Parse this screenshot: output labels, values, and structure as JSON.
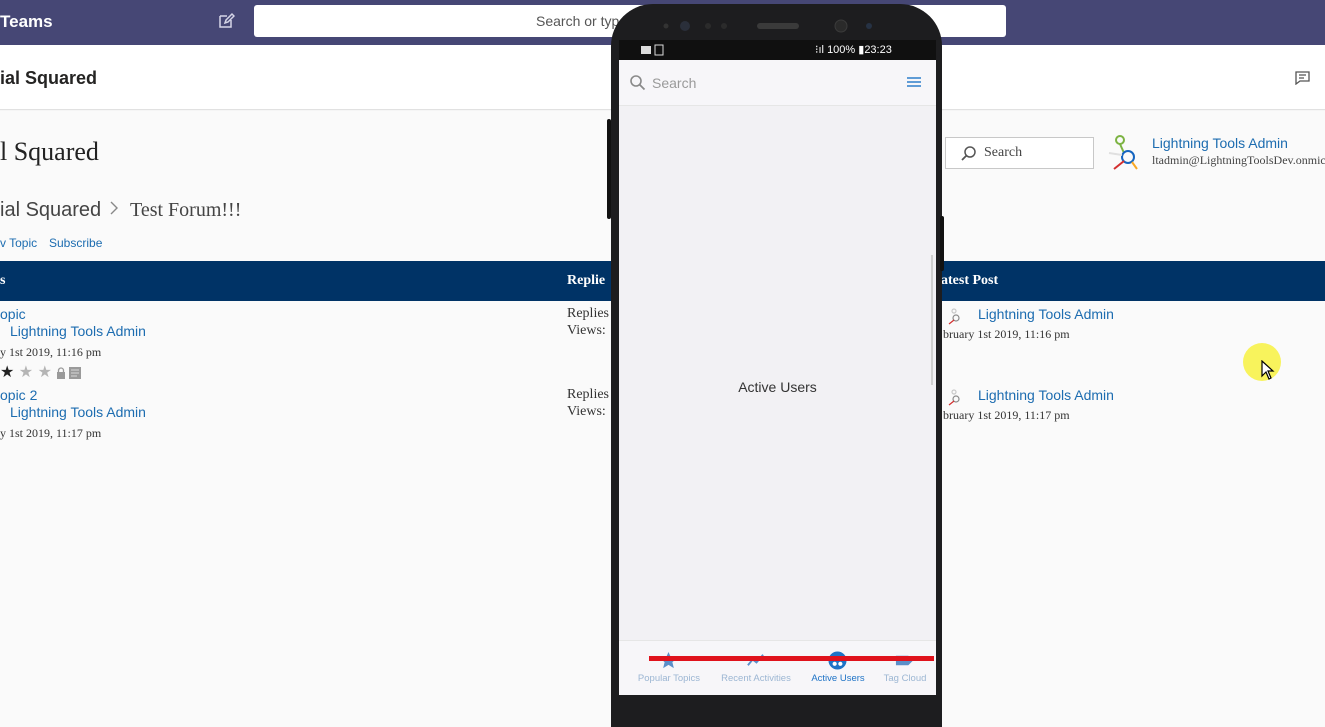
{
  "teams": {
    "app_title": "Teams",
    "search_placeholder": "Search or typ",
    "channel_title": "ial Squared"
  },
  "forum": {
    "heading": "l Squared",
    "search_label": "Search",
    "user": {
      "name": "Lightning Tools Admin",
      "email": "ltadmin@LightningToolsDev.onmic"
    },
    "breadcrumb": {
      "root": "ial Squared",
      "separator": ">",
      "current": "Test Forum!!!"
    },
    "actions": {
      "new_topic": "v Topic",
      "subscribe": "Subscribe"
    },
    "columns": {
      "topics": "s",
      "replies": "Replie",
      "latest_post": "atest Post"
    },
    "topics": [
      {
        "title": "opic",
        "author": "Lightning Tools Admin",
        "date": "y 1st 2019, 11:16 pm",
        "replies_label": "Replies",
        "views_label": "Views:",
        "latest_author": "Lightning Tools Admin",
        "latest_date": "bruary 1st 2019, 11:16 pm",
        "rating": "1 of 3 stars"
      },
      {
        "title": "opic 2",
        "author": "Lightning Tools Admin",
        "date": "y 1st 2019, 11:17 pm",
        "replies_label": "Replies",
        "views_label": "Views:",
        "latest_author": "Lightning Tools Admin",
        "latest_date": "bruary 1st 2019, 11:17 pm"
      }
    ]
  },
  "phone": {
    "status": {
      "battery": "100%",
      "time": "23:23"
    },
    "search_placeholder": "Search",
    "content_label": "Active Users",
    "tabs": [
      {
        "label": "Popular Topics",
        "icon": "star-icon"
      },
      {
        "label": "Recent Activities",
        "icon": "trend-icon"
      },
      {
        "label": "Active Users",
        "icon": "users-icon",
        "active": true
      },
      {
        "label": "Tag Cloud",
        "icon": "tag-icon"
      }
    ]
  },
  "colors": {
    "teams_bar": "#464775",
    "table_header": "#003366",
    "link": "#1c6cb0",
    "active_tab": "#1e73c6",
    "nav_strip": "#e0121c"
  }
}
